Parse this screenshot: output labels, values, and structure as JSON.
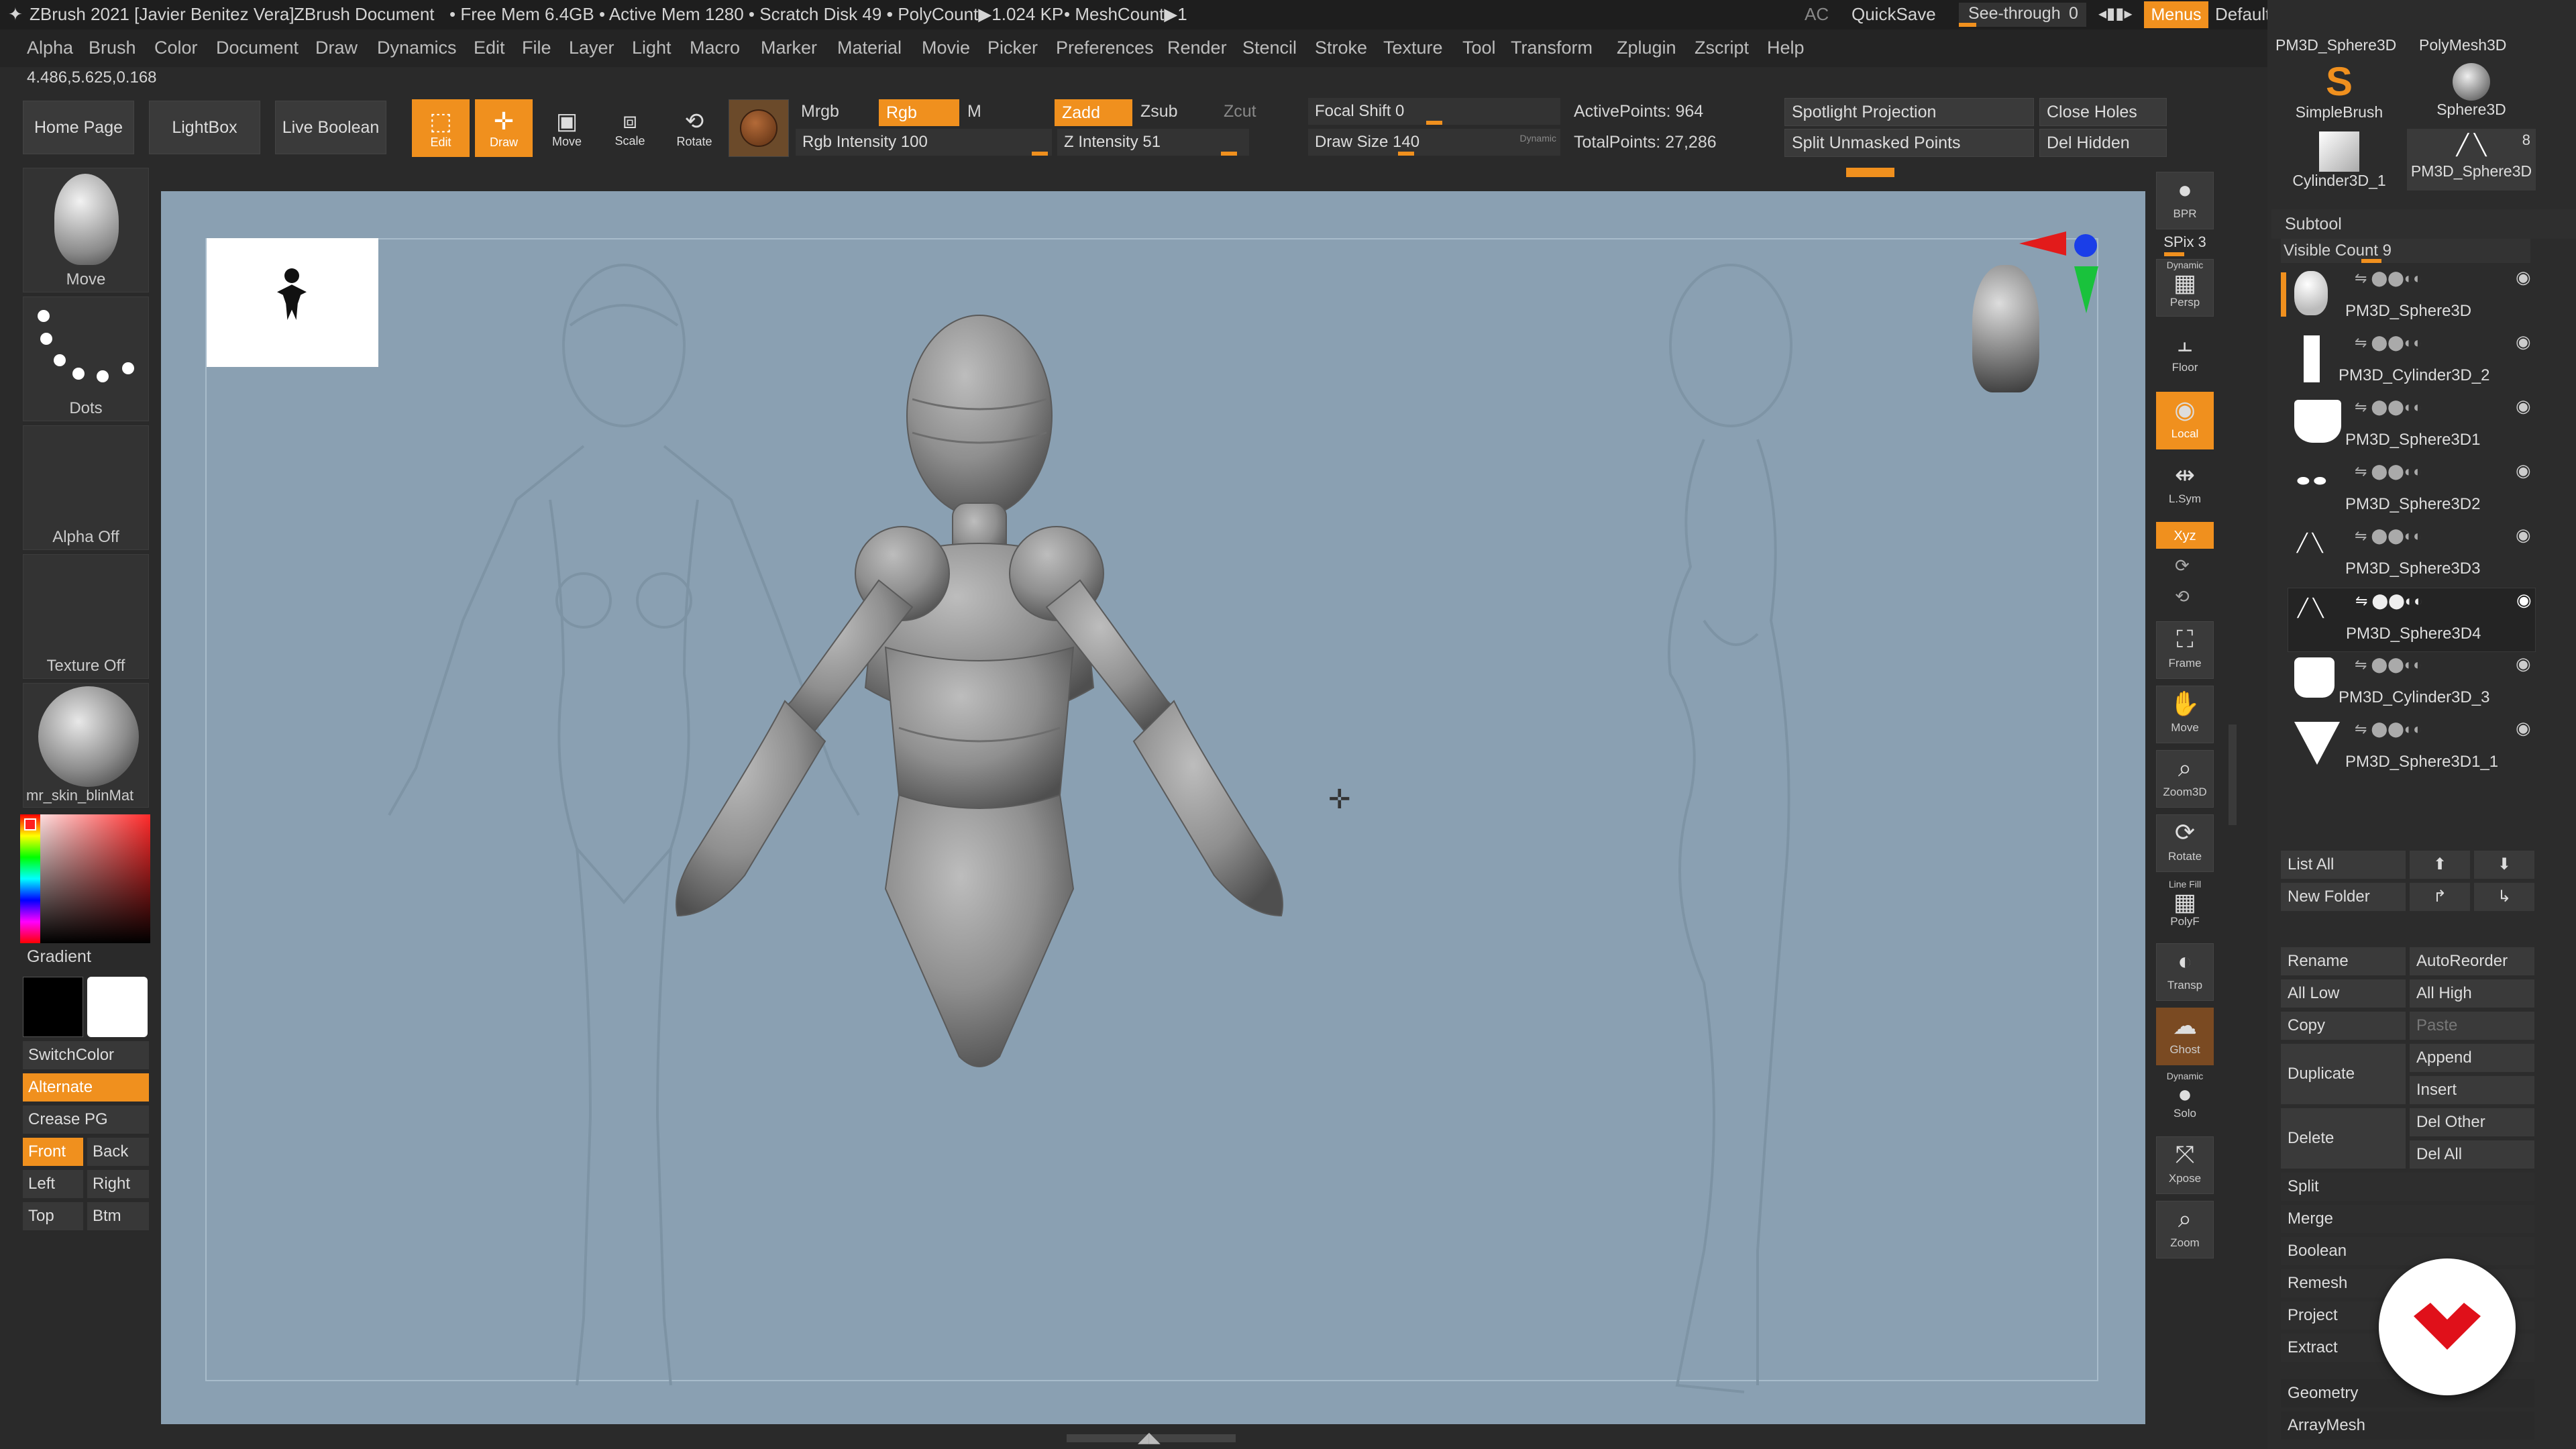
{
  "title": {
    "app": "ZBrush 2021 [Javier Benitez Vera]",
    "document": "ZBrush Document",
    "stats": "• Free Mem 6.4GB • Active Mem 1280 • Scratch Disk 49 •",
    "polycount": "• PolyCount▶1.024 KP",
    "meshcount": "• MeshCount▶1",
    "ac": "AC",
    "quicksave": "QuickSave",
    "seethrough": "See-through",
    "seethrough_value": "0",
    "menus": "Menus",
    "script": "DefaultZScript"
  },
  "coords": "4.486,5.625,0.168",
  "menu": [
    "Alpha",
    "Brush",
    "Color",
    "Document",
    "Draw",
    "Dynamics",
    "Edit",
    "File",
    "Layer",
    "Light",
    "Macro",
    "Marker",
    "Material",
    "Movie",
    "Picker",
    "Preferences",
    "Render",
    "Stencil",
    "Stroke",
    "Texture",
    "Tool",
    "Transform",
    "Zplugin",
    "Zscript",
    "Help"
  ],
  "shelf": {
    "home": "Home Page",
    "lightbox": "LightBox",
    "liveboolean": "Live Boolean",
    "edit": "Edit",
    "draw": "Draw",
    "move": "Move",
    "scale": "Scale",
    "rotate": "Rotate",
    "mrgb": "Mrgb",
    "rgb": "Rgb",
    "m": "M",
    "rgb_intensity": "Rgb Intensity 100",
    "zadd": "Zadd",
    "zsub": "Zsub",
    "zcut": "Zcut",
    "z_intensity": "Z Intensity 51",
    "focal_shift": "Focal Shift 0",
    "draw_size": "Draw Size 140",
    "dynamic": "Dynamic",
    "active_points": "ActivePoints: 964",
    "total_points": "TotalPoints: 27,286",
    "spotlight": "Spotlight Projection",
    "split_unmasked": "Split Unmasked Points",
    "close_holes": "Close Holes",
    "del_hidden": "Del Hidden"
  },
  "left": {
    "brush": "Move",
    "stroke": "Dots",
    "alpha": "Alpha Off",
    "texture": "Texture Off",
    "material": "mr_skin_blinMat",
    "gradient": "Gradient",
    "switchcolor": "SwitchColor",
    "alternate": "Alternate",
    "crease": "Crease PG",
    "front": "Front",
    "back": "Back",
    "leftv": "Left",
    "right": "Right",
    "top": "Top",
    "btm": "Btm"
  },
  "rightshelf": {
    "bpr": "BPR",
    "spix": "SPix 3",
    "dynamic": "Dynamic",
    "persp": "Persp",
    "floor": "Floor",
    "local": "Local",
    "lsym": "L.Sym",
    "xyz": "Xyz",
    "frame": "Frame",
    "move": "Move",
    "zoom3d": "Zoom3D",
    "rotate": "Rotate",
    "linefill": "Line Fill",
    "polyf": "PolyF",
    "transp": "Transp",
    "ghost": "Ghost",
    "solo_dyn": "Dynamic",
    "solo": "Solo",
    "xpose": "Xpose",
    "zoom": "Zoom"
  },
  "tools": {
    "t1": "PM3D_Sphere3D",
    "t2": "PolyMesh3D",
    "t3": "SimpleBrush",
    "t4": "Sphere3D",
    "t5": "Cylinder3D_1",
    "t6": "PM3D_Sphere3D",
    "count": "8"
  },
  "subtool": {
    "header": "Subtool",
    "visible_count": "Visible Count 9",
    "items": [
      "PM3D_Sphere3D",
      "PM3D_Cylinder3D_2",
      "PM3D_Sphere3D1",
      "PM3D_Sphere3D2",
      "PM3D_Sphere3D3",
      "PM3D_Sphere3D4",
      "PM3D_Cylinder3D_3",
      "PM3D_Sphere3D1_1"
    ],
    "list_all": "List All",
    "new_folder": "New Folder",
    "rename": "Rename",
    "autoreorder": "AutoReorder",
    "all_low": "All Low",
    "all_high": "All High",
    "copy": "Copy",
    "paste": "Paste",
    "duplicate": "Duplicate",
    "append": "Append",
    "insert": "Insert",
    "delete": "Delete",
    "del_other": "Del Other",
    "del_all": "Del All",
    "split": "Split",
    "merge": "Merge",
    "boolean": "Boolean",
    "remesh": "Remesh",
    "project": "Project",
    "extract": "Extract",
    "geometry": "Geometry",
    "arraymesh": "ArrayMesh"
  },
  "colors": {
    "accent": "#f0901e",
    "viewport": "#8aa0b2",
    "panel": "#2a2a2a"
  }
}
